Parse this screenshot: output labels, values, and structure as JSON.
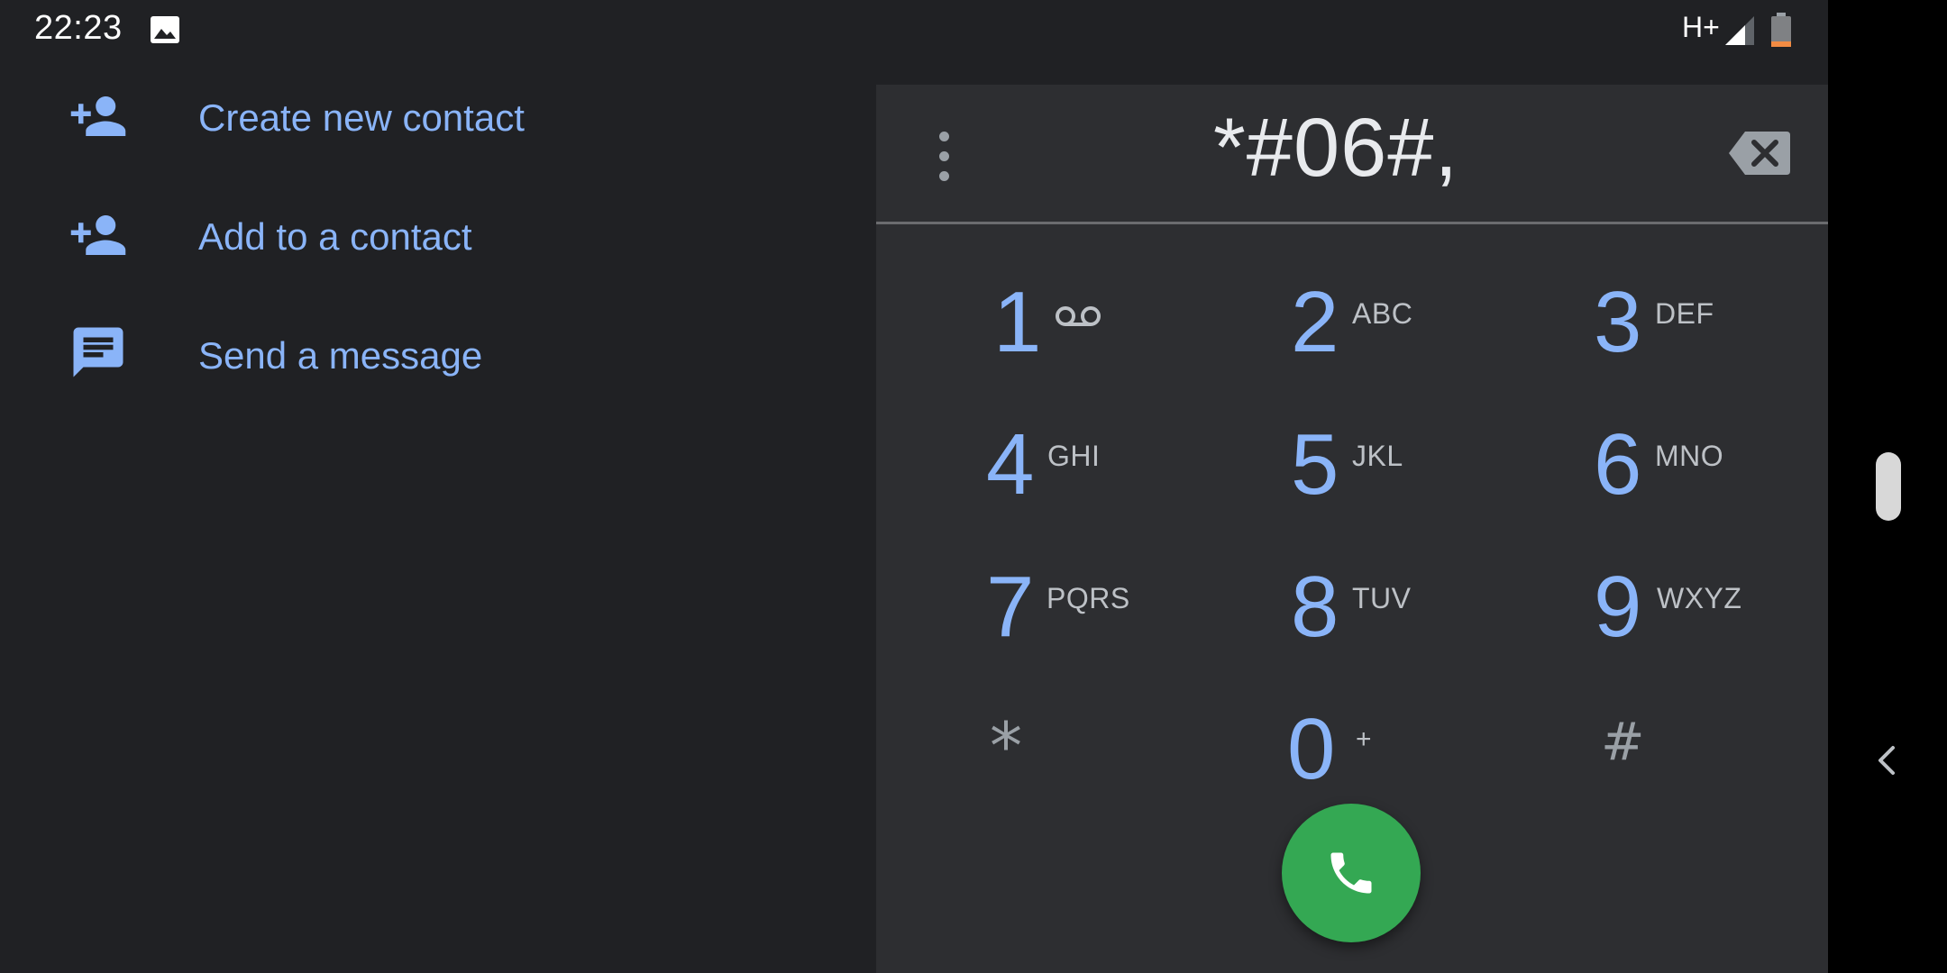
{
  "status_bar": {
    "time": "22:23",
    "network": "H+",
    "icons": [
      "gallery-icon",
      "signal-icon",
      "battery-icon"
    ]
  },
  "actions": [
    {
      "label": "Create new contact",
      "icon": "person-add-icon"
    },
    {
      "label": "Add to a contact",
      "icon": "person-add-icon"
    },
    {
      "label": "Send a message",
      "icon": "message-icon"
    }
  ],
  "dialer": {
    "digits": "*#06#,",
    "keys": {
      "k1": {
        "digit": "1",
        "letters": ""
      },
      "k2": {
        "digit": "2",
        "letters": "ABC"
      },
      "k3": {
        "digit": "3",
        "letters": "DEF"
      },
      "k4": {
        "digit": "4",
        "letters": "GHI"
      },
      "k5": {
        "digit": "5",
        "letters": "JKL"
      },
      "k6": {
        "digit": "6",
        "letters": "MNO"
      },
      "k7": {
        "digit": "7",
        "letters": "PQRS"
      },
      "k8": {
        "digit": "8",
        "letters": "TUV"
      },
      "k9": {
        "digit": "9",
        "letters": "WXYZ"
      },
      "kstar": {
        "digit": "*",
        "letters": ""
      },
      "k0": {
        "digit": "0",
        "letters": "+"
      },
      "khash": {
        "digit": "#",
        "letters": ""
      }
    }
  },
  "colors": {
    "background": "#202124",
    "panel": "#2d2e31",
    "accent": "#8ab4f8",
    "call": "#34a853"
  }
}
